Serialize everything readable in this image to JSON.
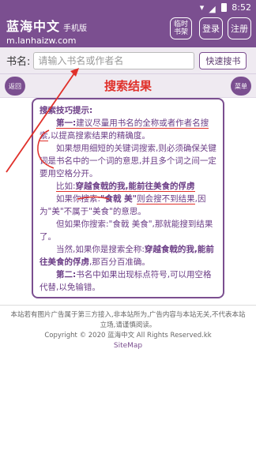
{
  "status": {
    "time": "8:52"
  },
  "header": {
    "brand_title": "蓝海中文",
    "brand_sub": "手机版",
    "brand_domain": "m.lanhaizw.com",
    "btn_history_1": "临时",
    "btn_history_2": "书架",
    "btn_login": "登录",
    "btn_register": "注册"
  },
  "search": {
    "label": "书名:",
    "placeholder": "请输入书名或作者名",
    "value": "",
    "quick_button": "快速搜书"
  },
  "titlebar": {
    "back_label": "返回",
    "title": "搜索结果",
    "menu_label": "菜单"
  },
  "tips": {
    "heading": "搜索技巧提示:",
    "p1_label": "第一:",
    "p1_text_a": "建议尽量用书名的全称或者作者名搜索",
    "p1_text_b": ",以提高搜索结果的精确度。",
    "p2": "如果想用细短的关键词搜索,则必须确保关键词是书名中的一个词的意思,并且多个词之间一定要用空格分开。",
    "p3_label": "比如:",
    "p3_text": "穿越食戟的我,能前往美食的俘虏",
    "p4_a": "如果你搜索:",
    "p4_q": "\"食戟 美\"",
    "p4_b": "则会搜不到结果",
    "p4_c": ",因为",
    "p4_d": "\"美\"不属于\"美食\"的意思。",
    "p5": "但如果你搜索:\"食戟 美食\",那就能搜到结果了。",
    "p6_a": "当然,如果你是搜索全称:",
    "p6_b": "穿越食戟的我,能前往美食的俘虏",
    "p6_c": ",那百分百准确。",
    "p7_label": "第二:",
    "p7_text": "书名中如果出现标点符号,可以用空格代替,以免输错。"
  },
  "footer": {
    "line1": "本站若有图片广告属于第三方接入,非本站所为,广告内容与本站无关,不代表本站立场,请谨慎阅读。",
    "line2": "Copyright © 2020 蓝海中文 All Rights Reserved.kk",
    "sitemap": "SiteMap"
  },
  "colors": {
    "primary": "#7b4f90",
    "accent_red": "#e0302a"
  }
}
